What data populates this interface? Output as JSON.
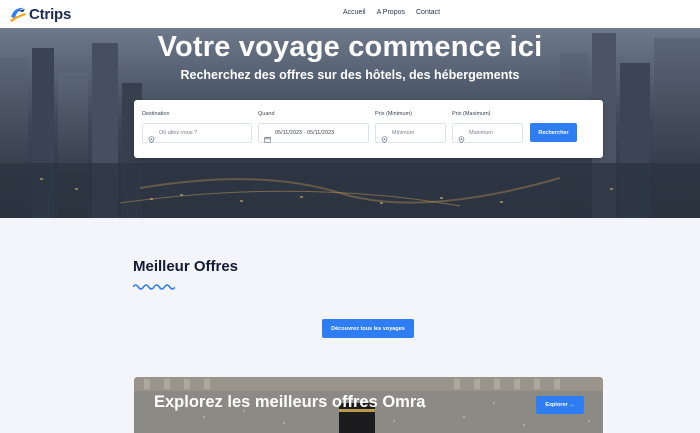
{
  "brand": {
    "name": "Ctrips"
  },
  "nav": {
    "items": [
      "Accueil",
      "A Propos",
      "Contact"
    ]
  },
  "hero": {
    "title": "Votre voyage commence ici",
    "subtitle": "Recherchez des offres sur des hôtels, des hébergements"
  },
  "search": {
    "destination_label": "Destination",
    "destination_placeholder": "Où allez-vous ?",
    "when_label": "Quand",
    "when_value": "05/11/2023 - 05/11/2023",
    "min_label": "Prix (Minimum)",
    "min_placeholder": "Minimum",
    "max_label": "Prix (Maximum)",
    "max_placeholder": "Maximum",
    "submit_label": "Rechercher"
  },
  "offers": {
    "title": "Meilleur Offres",
    "all_button": "Découvrez tous les voyages"
  },
  "banner": {
    "title": "Explorez les meilleurs offres Omra",
    "button": "Explorer →"
  },
  "colors": {
    "accent": "#2f7df2",
    "navy": "#1b2b55",
    "background": "#f3f5fa"
  },
  "icons": [
    "logo-plane-icon",
    "pin-icon",
    "calendar-icon",
    "arrow-right-icon"
  ]
}
